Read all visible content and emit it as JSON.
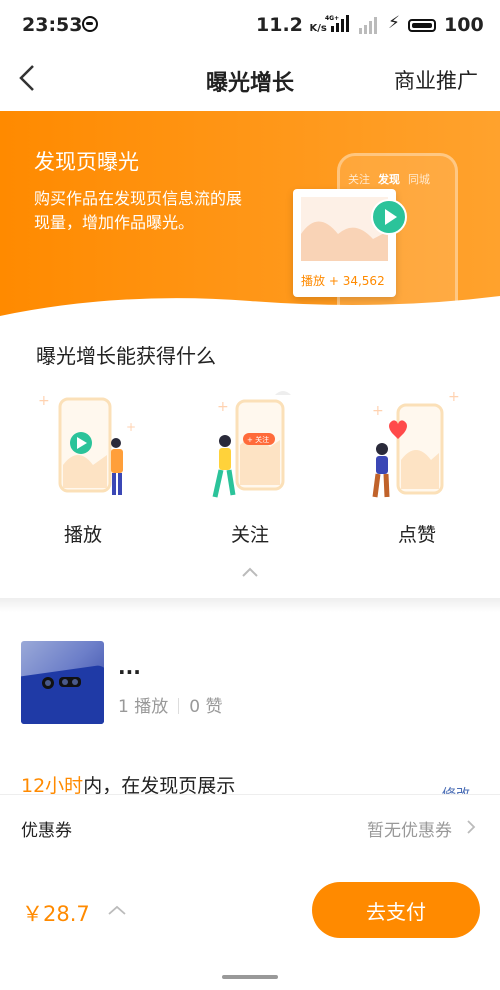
{
  "status_bar": {
    "time": "23:53",
    "speed_value": "11.2",
    "speed_unit": "K/s",
    "network": "4G+",
    "battery": "100"
  },
  "nav": {
    "title": "曝光增长",
    "right_label": "商业推广"
  },
  "banner": {
    "title": "发现页曝光",
    "desc": "购买作品在发现页信息流的展现量，增加作品曝光。",
    "phone_tabs": [
      "关注",
      "发现",
      "同城"
    ],
    "card_plays_label": "播放",
    "card_plays_value": "+ 34,562"
  },
  "benefits": {
    "title": "曝光增长能获得什么",
    "items": [
      {
        "label": "播放",
        "icon": "play-icon"
      },
      {
        "label": "关注",
        "icon": "follow-icon",
        "badge": "+ 关注"
      },
      {
        "label": "点赞",
        "icon": "heart-icon"
      }
    ]
  },
  "work": {
    "title": "...",
    "plays": "1 播放",
    "likes": "0 赞"
  },
  "timeline": {
    "highlight": "12小时",
    "text": "内，在发现页展示",
    "edit_peek": "修改"
  },
  "coupon": {
    "label": "优惠券",
    "value": "暂无优惠券"
  },
  "paybar": {
    "price": "￥28.7",
    "button": "去支付"
  },
  "colors": {
    "accent": "#ff8a00",
    "link": "#4a6db5"
  }
}
